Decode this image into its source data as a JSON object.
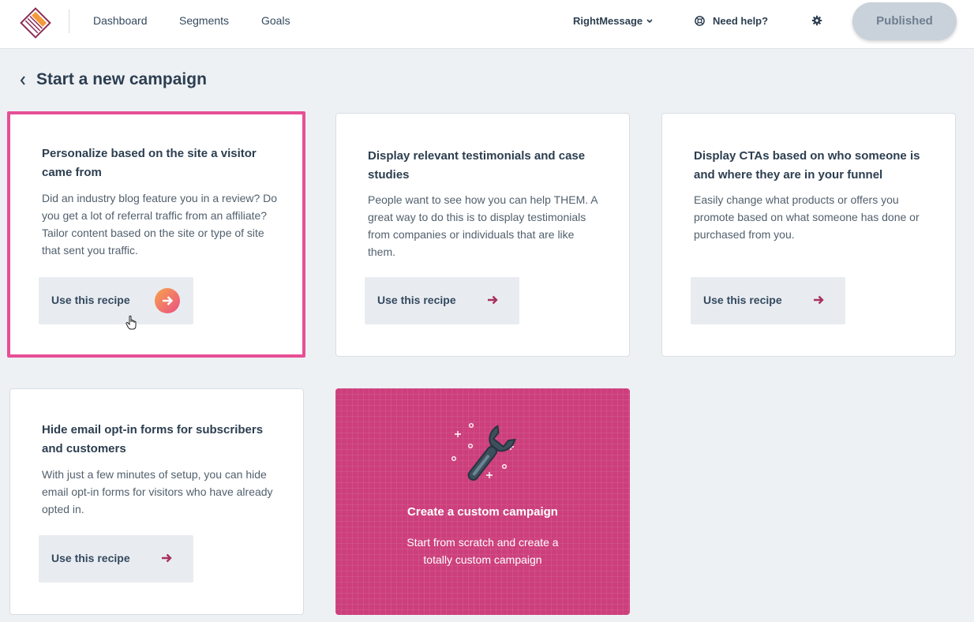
{
  "nav": {
    "items": [
      {
        "label": "Dashboard"
      },
      {
        "label": "Segments"
      },
      {
        "label": "Goals"
      }
    ],
    "account_label": "RightMessage",
    "help_label": "Need help?",
    "publish_label": "Published"
  },
  "page": {
    "title": "Start a new campaign"
  },
  "recipes": [
    {
      "title": "Personalize based on the site a visitor came from",
      "description": "Did an industry blog feature you in a review? Do you get a lot of referral traffic from an affiliate? Tailor content based on the site or type of site that sent you traffic.",
      "button_label": "Use this recipe"
    },
    {
      "title": "Display relevant testimonials and case studies",
      "description": "People want to see how you can help THEM. A great way to do this is to display testimonials from companies or individuals that are like them.",
      "button_label": "Use this recipe"
    },
    {
      "title": "Display CTAs based on who someone is and where they are in your funnel",
      "description": "Easily change what products or offers you promote based on what someone has done or purchased from you.",
      "button_label": "Use this recipe"
    },
    {
      "title": "Hide email opt-in forms for subscribers and customers",
      "description": "With just a few minutes of setup, you can hide email opt-in forms for visitors who have already opted in.",
      "button_label": "Use this recipe"
    }
  ],
  "custom": {
    "title": "Create a custom campaign",
    "description": "Start from scratch and create a totally custom campaign"
  },
  "colors": {
    "accent_pink": "#e74f95",
    "custom_card_bg": "#cc3f7c",
    "arrow_color": "#a8315f",
    "button_bg": "#e8ecf1",
    "published_bg": "#c9d1da"
  },
  "icons": [
    "logo-icon",
    "chevron-down-icon",
    "help-circle-icon",
    "gear-icon",
    "chevron-left-icon",
    "arrow-right-icon",
    "hand-cursor-icon",
    "wrench-icon"
  ]
}
